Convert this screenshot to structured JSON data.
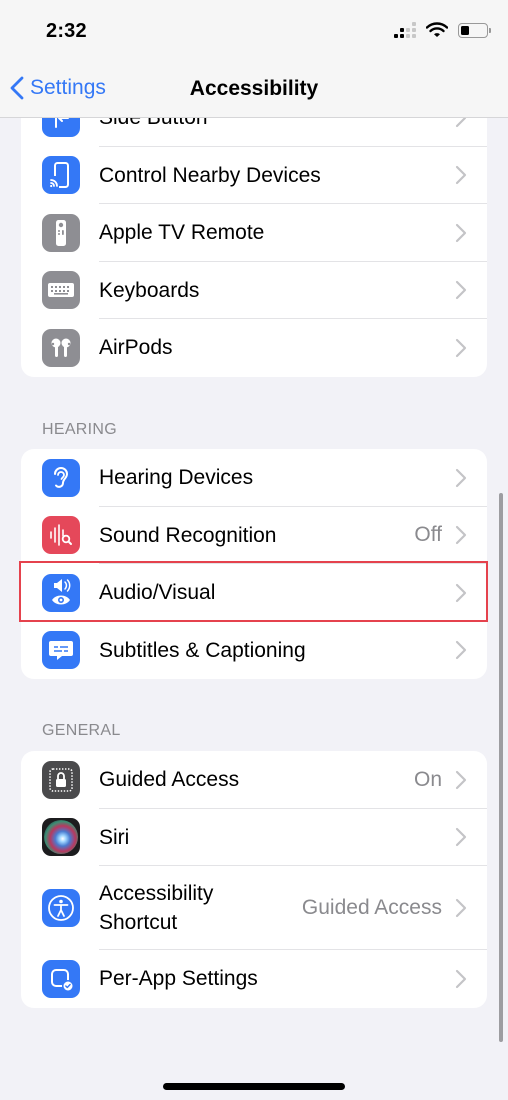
{
  "status_bar": {
    "time": "2:32",
    "icons": [
      "cellular-signal-icon",
      "wifi-icon",
      "battery-icon"
    ],
    "battery_level_percent": 25
  },
  "nav": {
    "back_label": "Settings",
    "title": "Accessibility"
  },
  "colors": {
    "accent": "#3478f6",
    "background": "#f2f2f7",
    "secondary_text": "#8a8a8e",
    "highlight_border": "#e5424d"
  },
  "groups": [
    {
      "header": "",
      "items": [
        {
          "label": "Side Button",
          "value": "",
          "icon": "side-button-icon",
          "icon_color": "#3478f6"
        },
        {
          "label": "Control Nearby Devices",
          "value": "",
          "icon": "nearby-devices-icon",
          "icon_color": "#3478f6"
        },
        {
          "label": "Apple TV Remote",
          "value": "",
          "icon": "tv-remote-icon",
          "icon_color": "#8e8e93"
        },
        {
          "label": "Keyboards",
          "value": "",
          "icon": "keyboard-icon",
          "icon_color": "#8e8e93"
        },
        {
          "label": "AirPods",
          "value": "",
          "icon": "airpods-icon",
          "icon_color": "#8e8e93"
        }
      ]
    },
    {
      "header": "HEARING",
      "items": [
        {
          "label": "Hearing Devices",
          "value": "",
          "icon": "ear-icon",
          "icon_color": "#3478f6"
        },
        {
          "label": "Sound Recognition",
          "value": "Off",
          "icon": "sound-recognition-icon",
          "icon_color": "#e5485a"
        },
        {
          "label": "Audio/Visual",
          "value": "",
          "icon": "audio-visual-icon",
          "icon_color": "#3478f6",
          "highlighted": true
        },
        {
          "label": "Subtitles & Captioning",
          "value": "",
          "icon": "captioning-icon",
          "icon_color": "#3478f6"
        }
      ]
    },
    {
      "header": "GENERAL",
      "items": [
        {
          "label": "Guided Access",
          "value": "On",
          "icon": "guided-access-lock-icon",
          "icon_color": "#4a4a4c"
        },
        {
          "label": "Siri",
          "value": "",
          "icon": "siri-icon",
          "icon_color": "#1c1c1e"
        },
        {
          "label": "Accessibility\nShortcut",
          "value": "Guided Access",
          "icon": "accessibility-icon",
          "icon_color": "#3478f6"
        },
        {
          "label": "Per-App Settings",
          "value": "",
          "icon": "per-app-settings-icon",
          "icon_color": "#3478f6"
        }
      ]
    }
  ]
}
